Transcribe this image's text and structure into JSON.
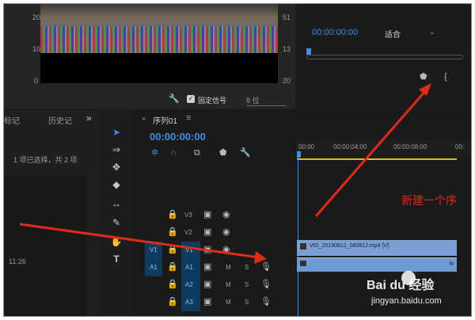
{
  "scope": {
    "y_labels": [
      "20",
      "10",
      "0"
    ],
    "y_labels_right": [
      "51",
      "13",
      "20"
    ],
    "fixed_signal_label": "固定信号",
    "bits_value": "8 位"
  },
  "program_monitor": {
    "timecode": "00:00:00:00",
    "fit_select": "适合"
  },
  "project_panel": {
    "tab_markers": "标记",
    "tab_history": "历史记",
    "expand": "»",
    "selection_info": "1 项已选择，共 2 项",
    "duration": "11:26"
  },
  "timeline": {
    "tab_label": "序列01",
    "timecode": "00:00:00:00",
    "ruler_ticks": [
      ":00:00",
      "00:00:04:00",
      "00:00:08:00",
      "00:"
    ],
    "clip_label": "VID_20190812_080812.mp4 [V]",
    "audio_clip_fx": "fx",
    "annotation": "新建一个序",
    "tracks": [
      {
        "name": "V3",
        "type": "video"
      },
      {
        "name": "V2",
        "type": "video"
      },
      {
        "name": "V1",
        "type": "video",
        "source": "V1"
      },
      {
        "name": "A1",
        "type": "audio",
        "source": "A1"
      },
      {
        "name": "A2",
        "type": "audio"
      },
      {
        "name": "A3",
        "type": "audio"
      }
    ],
    "mute_label": "M",
    "solo_label": "S"
  },
  "watermark": {
    "brand": "Bai du 经验",
    "url": "jingyan.baidu.com"
  },
  "colors": {
    "accent_blue": "#3d8fe8",
    "arrow_red": "#e02a1a",
    "clip_blue": "#7b9fd1",
    "work_area": "#d8c31a"
  }
}
